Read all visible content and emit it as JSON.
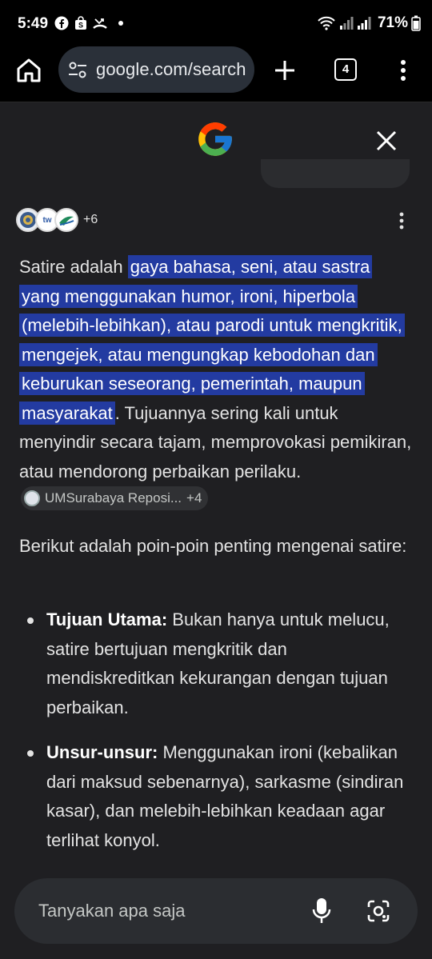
{
  "status_bar": {
    "time": "5:49",
    "battery_percent": "71%",
    "left_icons": [
      "facebook-icon",
      "shopping-bag-icon",
      "missed-call-icon",
      "dot-icon"
    ],
    "right_icons": [
      "wifi-icon",
      "signal-icon",
      "signal-icon",
      "battery-icon"
    ]
  },
  "toolbar": {
    "url": "google.com/search",
    "tab_count": "4",
    "icons": [
      "home-icon",
      "tune-icon",
      "plus-icon",
      "tabs-icon",
      "more-vert-icon"
    ]
  },
  "header": {
    "logo": "google-g-logo",
    "close_icon": "close-icon"
  },
  "sources": {
    "more_count": "+6",
    "avatars": [
      "ums-logo",
      "tw-logo",
      "leaf-logo"
    ],
    "badge_text": "tw"
  },
  "answer": {
    "intro_plain": "Satire adalah ",
    "intro_highlight": "gaya bahasa, seni, atau sastra yang menggunakan humor, ironi, hiperbola (melebih-lebihkan), atau parodi untuk mengkritik, mengejek, atau mengungkap kebodohan dan keburukan seseorang, pemerintah, maupun masyarakat",
    "intro_rest": ". Tujuannya sering kali untuk menyindir secara tajam, memprovokasi pemikiran, atau mendorong perbaikan perilaku.",
    "citation_chip": {
      "label": "UMSurabaya Reposi...",
      "count": "+4"
    },
    "points_intro": "Berikut adalah poin-poin penting mengenai satire:",
    "bullets": [
      {
        "title": "Tujuan Utama:",
        "text": " Bukan hanya untuk melucu, satire bertujuan mengkritik dan mendiskreditkan kekurangan dengan tujuan perbaikan."
      },
      {
        "title": "Unsur-unsur:",
        "text": " Menggunakan ironi (kebalikan dari maksud sebenarnya), sarkasme (sindiran kasar), dan melebih-lebihkan keadaan agar terlihat konyol."
      }
    ]
  },
  "ask_bar": {
    "placeholder": "Tanyakan apa saja",
    "icons": [
      "mic-icon",
      "lens-icon"
    ]
  },
  "colors": {
    "highlight": "#233ba1",
    "background": "#1f1f22",
    "url_pill": "#2a3039"
  }
}
